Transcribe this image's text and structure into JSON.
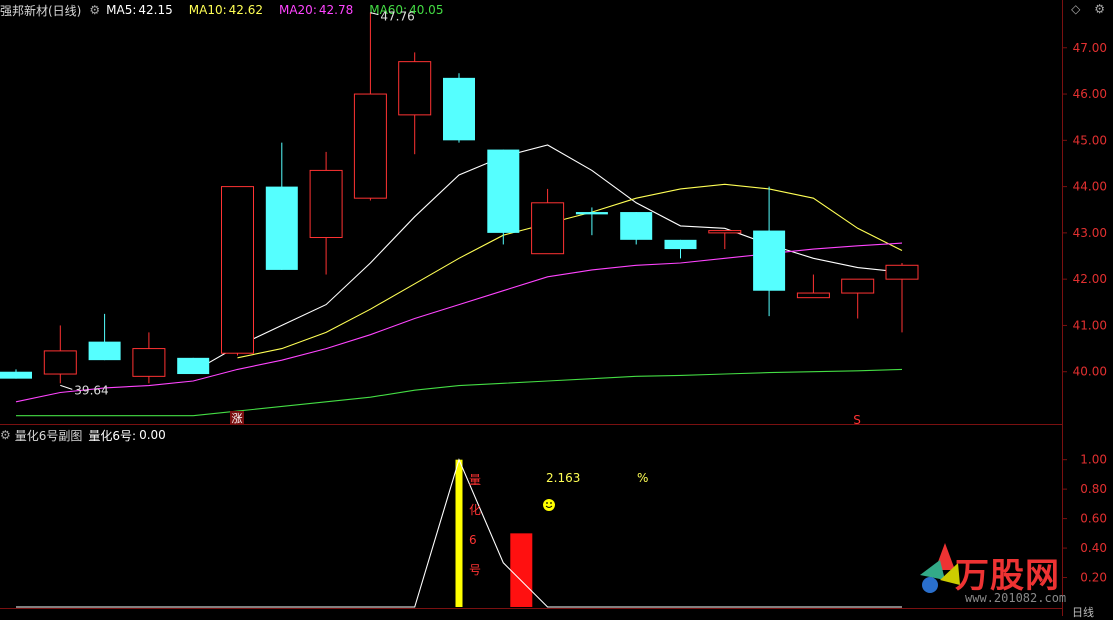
{
  "main_panel": {
    "stock_title": "强邦新材(日线)",
    "indicators": [
      {
        "label": "MA5:",
        "value": "42.15",
        "color": "#ffffff"
      },
      {
        "label": "MA10:",
        "value": "42.62",
        "color": "#ffff55"
      },
      {
        "label": "MA20:",
        "value": "42.78",
        "color": "#ff44ff"
      },
      {
        "label": "MA60:",
        "value": "40.05",
        "color": "#44dd44"
      }
    ],
    "annotations": {
      "high": "47.76",
      "low": "39.64",
      "zhang_marker": "涨",
      "s_marker": "S"
    }
  },
  "sub_panel": {
    "title": "量化6号副图",
    "value_label": "量化6号:",
    "value": "0.00",
    "annotation_value": "2.163",
    "percent": "%",
    "vertical_text": [
      "量",
      "化",
      "6",
      "号"
    ]
  },
  "brand": {
    "text": "万股网",
    "url": "www.201082.com"
  },
  "bottom_right_label": "日线",
  "colors": {
    "up": "#ff3333",
    "down": "#55ffff",
    "ma5": "#ffffff",
    "ma10": "#ffff55",
    "ma20": "#ff44ff",
    "ma60": "#44dd44"
  },
  "chart_data": [
    {
      "type": "candlestick",
      "title": "强邦新材(日线)",
      "ylim": [
        39.0,
        47.6
      ],
      "yticks": [
        40.0,
        41.0,
        42.0,
        43.0,
        44.0,
        45.0,
        46.0,
        47.0
      ],
      "ytick_labels": [
        "40.00",
        "41.00",
        "42.00",
        "43.00",
        "44.00",
        "45.00",
        "46.00",
        "47.00"
      ],
      "candles": [
        {
          "open": 40.0,
          "close": 39.85,
          "high": 40.05,
          "low": 39.85
        },
        {
          "open": 39.95,
          "close": 40.45,
          "high": 41.0,
          "low": 39.75
        },
        {
          "open": 40.65,
          "close": 40.25,
          "high": 41.25,
          "low": 40.25
        },
        {
          "open": 39.9,
          "close": 40.5,
          "high": 40.85,
          "low": 39.75
        },
        {
          "open": 40.3,
          "close": 39.95,
          "high": 40.3,
          "low": 39.95
        },
        {
          "open": 40.4,
          "close": 44.0,
          "high": 44.0,
          "low": 40.35
        },
        {
          "open": 44.0,
          "close": 42.2,
          "high": 44.95,
          "low": 42.2
        },
        {
          "open": 42.9,
          "close": 44.35,
          "high": 44.75,
          "low": 42.1
        },
        {
          "open": 43.75,
          "close": 46.0,
          "high": 47.76,
          "low": 43.7
        },
        {
          "open": 45.55,
          "close": 46.7,
          "high": 46.9,
          "low": 44.7
        },
        {
          "open": 46.35,
          "close": 45.0,
          "high": 46.45,
          "low": 44.95
        },
        {
          "open": 44.8,
          "close": 43.0,
          "high": 44.8,
          "low": 42.75
        },
        {
          "open": 42.55,
          "close": 43.65,
          "high": 43.95,
          "low": 42.55
        },
        {
          "open": 43.45,
          "close": 43.4,
          "high": 43.55,
          "low": 42.95
        },
        {
          "open": 43.45,
          "close": 42.85,
          "high": 43.45,
          "low": 42.75
        },
        {
          "open": 42.85,
          "close": 42.65,
          "high": 42.85,
          "low": 42.45
        },
        {
          "open": 43.0,
          "close": 43.05,
          "high": 43.05,
          "low": 42.65
        },
        {
          "open": 43.05,
          "close": 41.75,
          "high": 44.0,
          "low": 41.2
        },
        {
          "open": 41.6,
          "close": 41.7,
          "high": 42.1,
          "low": 41.6
        },
        {
          "open": 41.7,
          "close": 42.0,
          "high": 42.0,
          "low": 41.15
        },
        {
          "open": 42.0,
          "close": 42.3,
          "high": 42.35,
          "low": 40.85
        }
      ],
      "series": [
        {
          "name": "MA5",
          "values": [
            null,
            null,
            null,
            null,
            40.0,
            40.55,
            41.0,
            41.45,
            42.35,
            43.35,
            44.25,
            44.65,
            44.9,
            44.35,
            43.65,
            43.15,
            43.1,
            42.75,
            42.45,
            42.25,
            42.15
          ],
          "color": "#ffffff"
        },
        {
          "name": "MA10",
          "values": [
            null,
            null,
            null,
            null,
            null,
            40.3,
            40.5,
            40.85,
            41.35,
            41.9,
            42.45,
            42.95,
            43.2,
            43.45,
            43.75,
            43.95,
            44.05,
            43.95,
            43.75,
            43.1,
            42.62
          ],
          "color": "#ffff55"
        },
        {
          "name": "MA20",
          "values": [
            39.35,
            39.55,
            39.65,
            39.7,
            39.8,
            40.05,
            40.25,
            40.5,
            40.8,
            41.15,
            41.45,
            41.75,
            42.05,
            42.2,
            42.3,
            42.35,
            42.45,
            42.55,
            42.65,
            42.72,
            42.78
          ],
          "color": "#ff44ff"
        },
        {
          "name": "MA60",
          "values": [
            39.05,
            39.05,
            39.05,
            39.05,
            39.05,
            39.15,
            39.25,
            39.35,
            39.45,
            39.6,
            39.7,
            39.75,
            39.8,
            39.85,
            39.9,
            39.92,
            39.95,
            39.98,
            40.0,
            40.02,
            40.05
          ],
          "color": "#44dd44"
        }
      ],
      "annotations": [
        {
          "text": "47.76"
        },
        {
          "text": "39.64"
        }
      ]
    },
    {
      "type": "line",
      "title": "量化6号副图",
      "ylim": [
        0.0,
        1.12
      ],
      "yticks": [
        0.2,
        0.4,
        0.6,
        0.8,
        1.0
      ],
      "ytick_labels": [
        "0.20",
        "0.40",
        "0.60",
        "0.80",
        "1.00"
      ],
      "series": [
        {
          "name": "量化6号",
          "values": [
            0.0,
            0.0,
            0.0,
            0.0,
            0.0,
            0.0,
            0.0,
            0.0,
            0.0,
            0.0,
            1.0,
            0.3,
            0.0,
            0.0,
            0.0,
            0.0,
            0.0,
            0.0,
            0.0,
            0.0,
            0.0
          ],
          "color": "#ffffff"
        }
      ],
      "bars": [
        {
          "index": 10,
          "value": 1.0,
          "color": "#ffff00"
        },
        {
          "index": 11,
          "value": 0.5,
          "color": "#ff1010"
        }
      ]
    }
  ]
}
